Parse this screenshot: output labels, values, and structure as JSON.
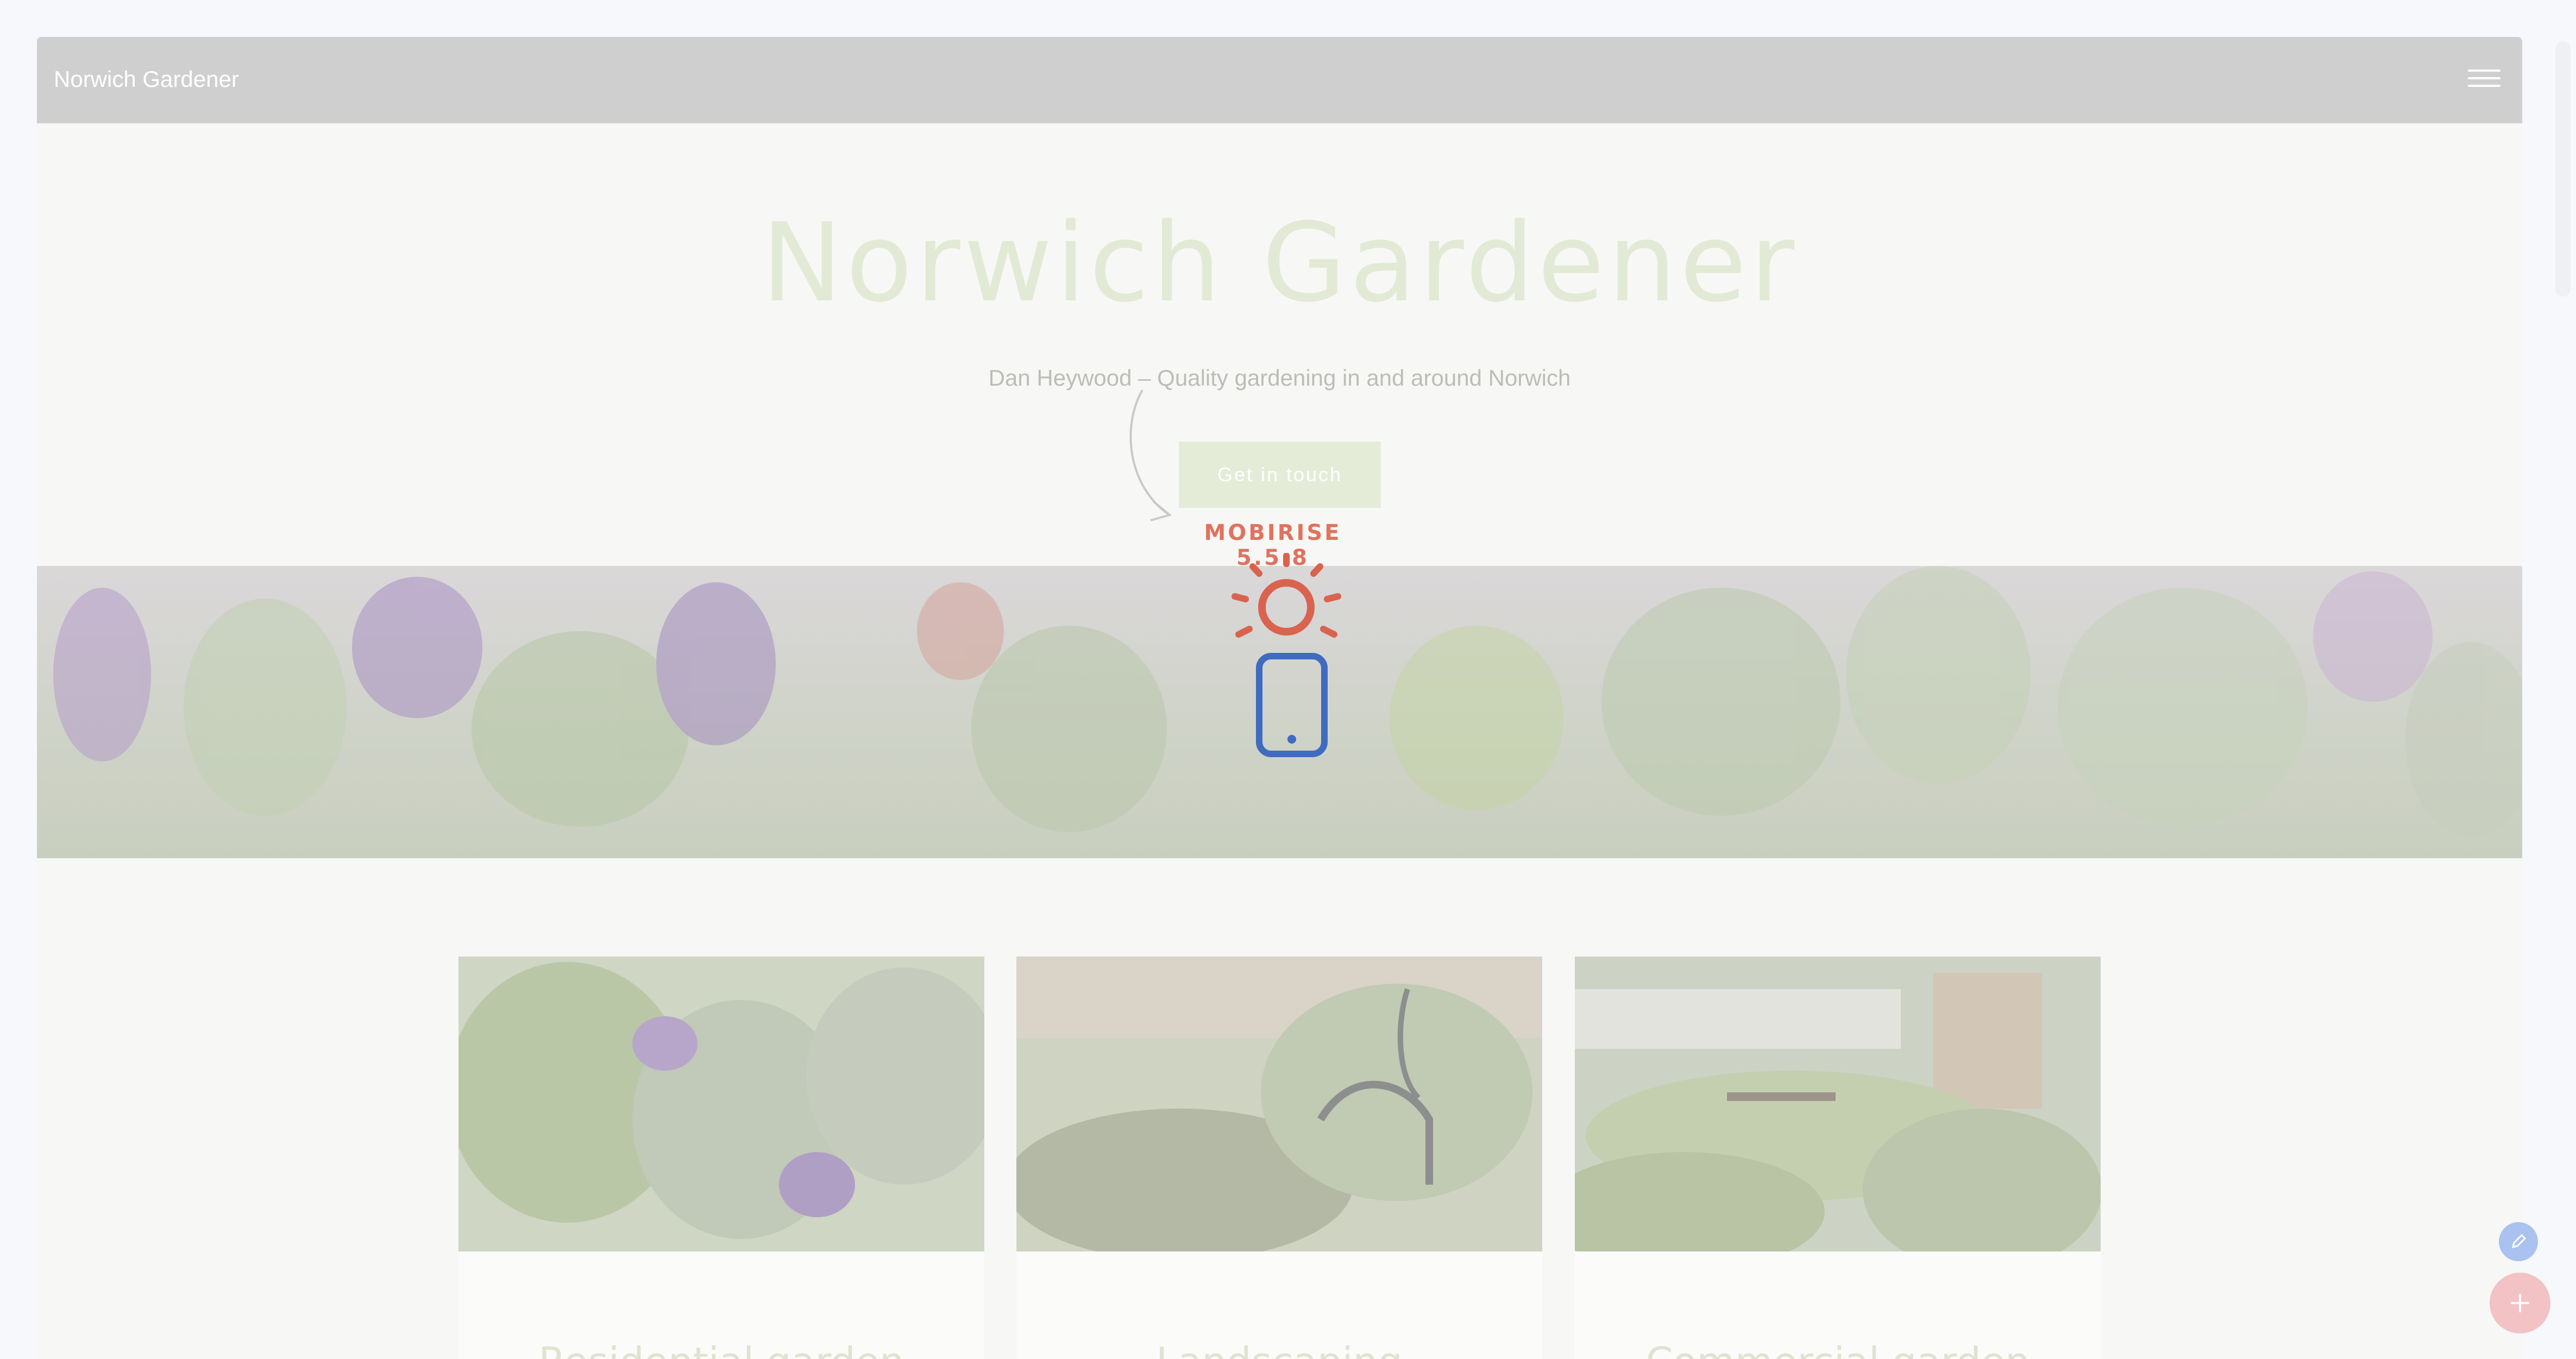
{
  "navbar": {
    "brand": "Norwich Gardener",
    "menu_icon": "hamburger-menu-icon"
  },
  "hero": {
    "title": "Norwich Gardener",
    "subtitle": "Dan Heywood – Quality gardening in and around Norwich",
    "cta_label": "Get in touch"
  },
  "loader": {
    "label": "MOBIRISE  5.5.8",
    "icons": [
      "sun-icon",
      "mobile-phone-icon"
    ]
  },
  "cards": [
    {
      "title": "Residential garden",
      "image": "flower-border-photo"
    },
    {
      "title": "Landscaping",
      "image": "pond-heron-photo"
    },
    {
      "title": "Commercial garden",
      "image": "picnic-garden-photo"
    }
  ],
  "floating_actions": {
    "edit_icon": "pencil-icon",
    "add_icon": "plus-icon"
  },
  "colors": {
    "navbar": "#cfcfcf",
    "hero_title": "#e2ead6",
    "cta": "#e4ecd8",
    "mobirise_accent": "#e0725f",
    "phone_blue": "#3f6bc0",
    "fab_edit": "#a9c2ef",
    "fab_add": "#f3c2c4"
  }
}
